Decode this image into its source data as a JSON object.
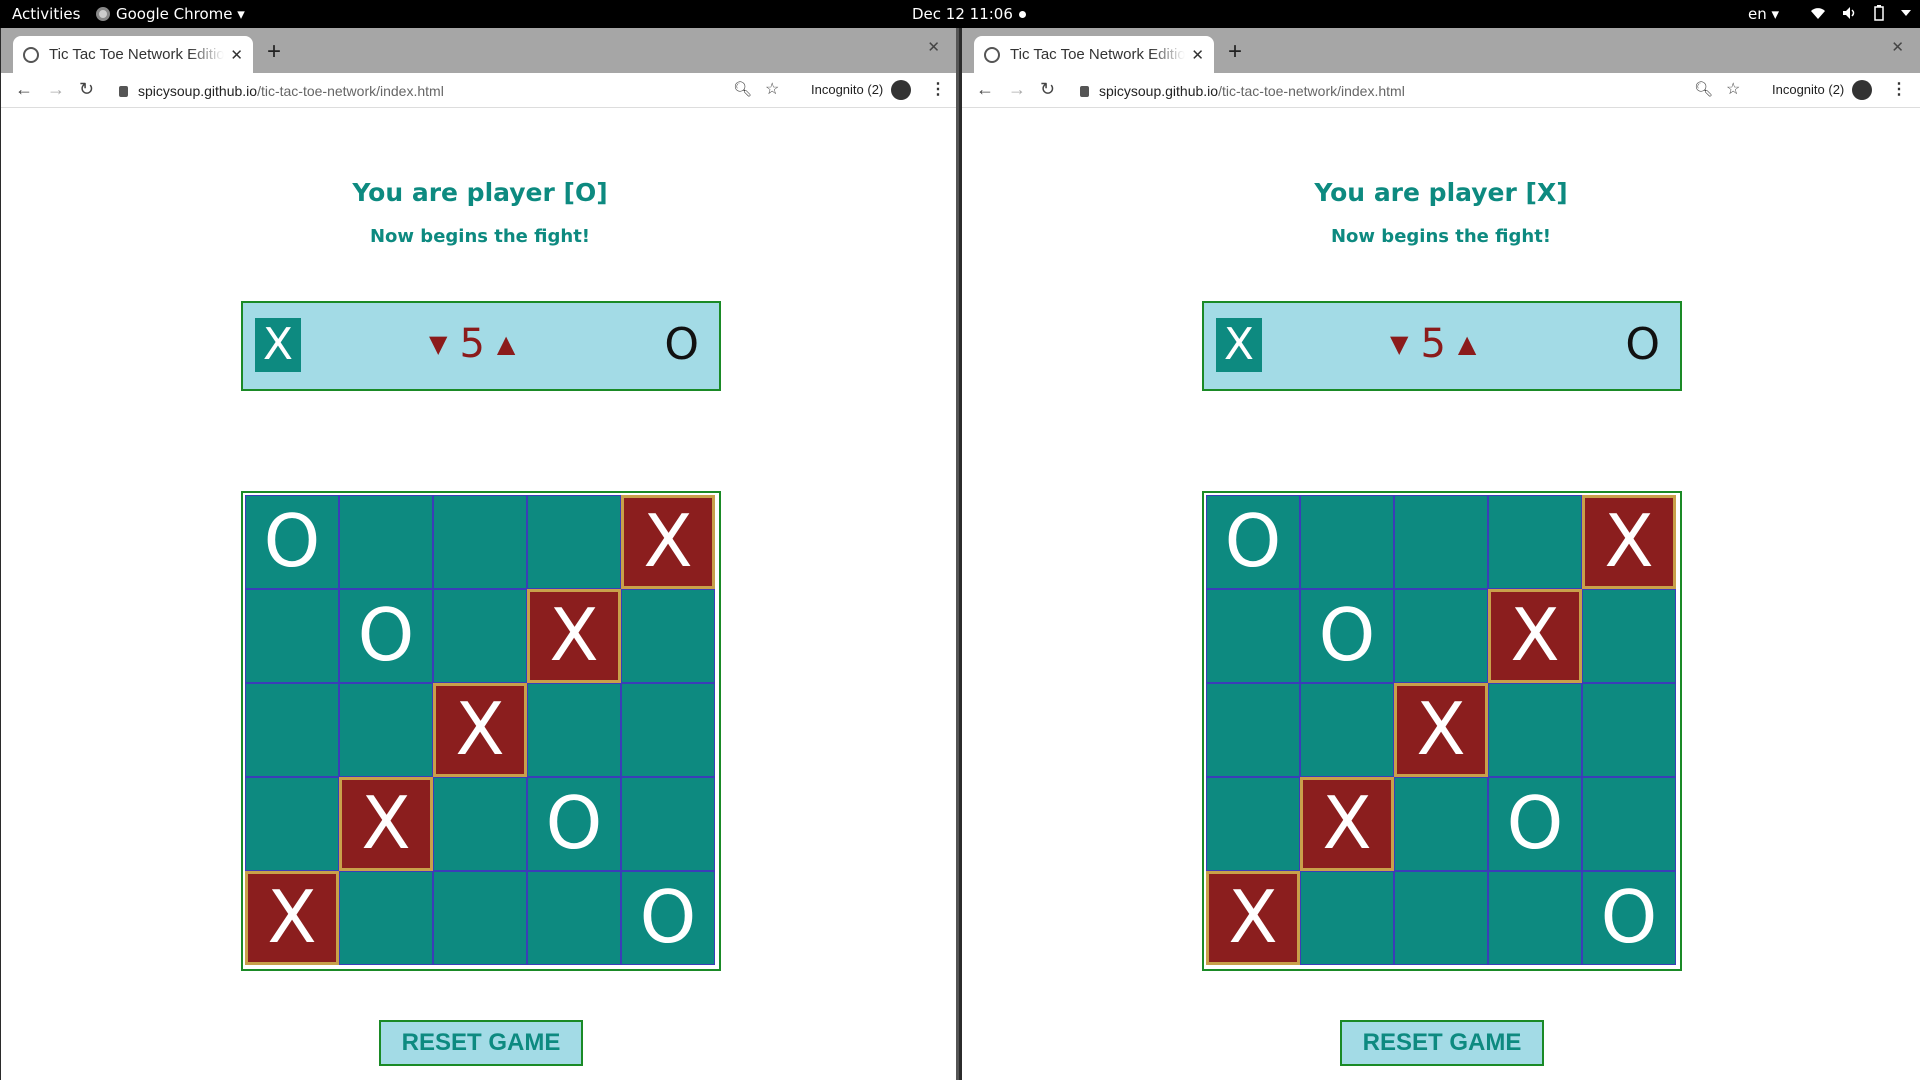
{
  "topbar": {
    "activities": "Activities",
    "app_name": "Google Chrome ▾",
    "clock": "Dec 12  11:06",
    "lang": "en ▾"
  },
  "windows": [
    {
      "tab_title": "Tic Tac Toe Network Edition",
      "url_host": "spicysoup.github.io",
      "url_path": "/tic-tac-toe-network/index.html",
      "incognito": "Incognito (2)",
      "player_title": "You are player [O]",
      "subtitle": "Now begins the fight!",
      "score": {
        "left": "X",
        "count": "5",
        "right": "O"
      },
      "reset_label": "RESET GAME"
    },
    {
      "tab_title": "Tic Tac Toe Network Edition",
      "url_host": "spicysoup.github.io",
      "url_path": "/tic-tac-toe-network/index.html",
      "incognito": "Incognito (2)",
      "player_title": "You are player [X]",
      "subtitle": "Now begins the fight!",
      "score": {
        "left": "X",
        "count": "5",
        "right": "O"
      },
      "reset_label": "RESET GAME"
    }
  ],
  "board": {
    "cells": [
      [
        "O",
        "",
        "",
        "",
        "X"
      ],
      [
        "",
        "O",
        "",
        "X",
        ""
      ],
      [
        "",
        "",
        "X",
        "",
        ""
      ],
      [
        "",
        "X",
        "",
        "O",
        ""
      ],
      [
        "X",
        "",
        "",
        "",
        "O"
      ]
    ],
    "winning_cells": [
      [
        0,
        4
      ],
      [
        1,
        3
      ],
      [
        2,
        2
      ],
      [
        3,
        1
      ],
      [
        4,
        0
      ]
    ]
  },
  "colors": {
    "teal": "#0d8a80",
    "win_red": "#8b1e1e",
    "panel_blue": "#a3dbe6",
    "border_green": "#1a8a26"
  }
}
